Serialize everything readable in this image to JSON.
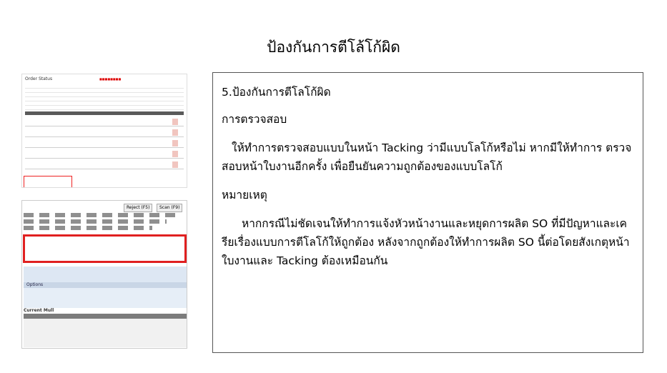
{
  "slide": {
    "title": "ป้องกันการตีโล้โก้ผิด"
  },
  "content": {
    "heading": "5.ป้องกันการตีโลโก้ผิด",
    "check_title": "การตรวจสอบ",
    "check_body": "ให้ทำการตรวจสอบแบบในหน้า Tacking ว่ามีแบบโลโก้หรือไม่ หากมีให้ทำการ ตรวจสอบหน้าใบงานอีกครั้ง เพื่อยืนยันความถูกต้องของแบบโลโก้",
    "note_title": "หมายเหตุ",
    "note_body": "หากกรณีไม่ชัดเจนให้ทำการแจ้งหัวหน้างานและหยุดการผลิต SO ที่มีปัญหาและเครียเรื่องแบบการตีโลโก้ให้ถูกต้อง หลังจากถูกต้องให้ทำการผลิต SO นี้ต่อโดยสังเกตุหน้าใบงานและ Tacking ต้องเหมือนกัน"
  },
  "screenshot_order_status": {
    "title": "Order Status"
  },
  "screenshot_tacking": {
    "reject_button": "Reject (F5)",
    "scan_button": "Scan (F9)",
    "options_label": "Options",
    "current_mull_label": "Current Mull"
  }
}
